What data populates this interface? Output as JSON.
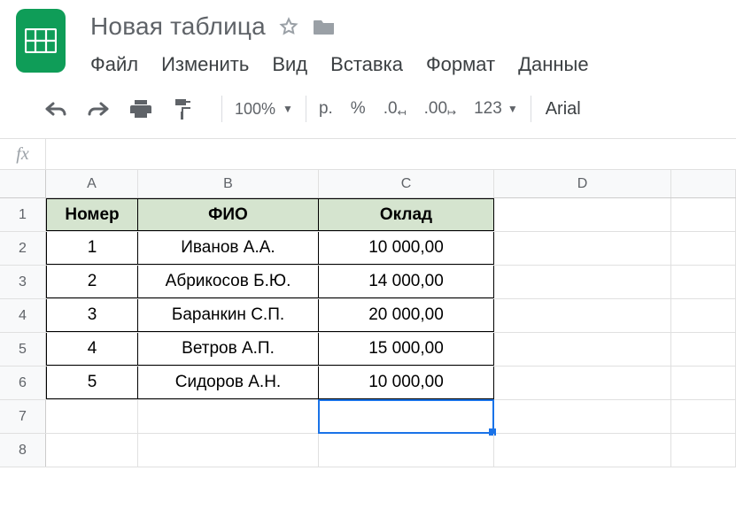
{
  "doc": {
    "title": "Новая таблица"
  },
  "menubar": {
    "file": "Файл",
    "edit": "Изменить",
    "view": "Вид",
    "insert": "Вставка",
    "format": "Формат",
    "data": "Данные"
  },
  "toolbar": {
    "zoom": "100%",
    "currency": "р.",
    "percent": "%",
    "dec_dec": ".0",
    "inc_dec": ".00",
    "numfmt": "123",
    "font": "Arial"
  },
  "formula_bar": {
    "fx": "fx",
    "value": ""
  },
  "columns": [
    "A",
    "B",
    "C",
    "D",
    ""
  ],
  "rows": [
    "1",
    "2",
    "3",
    "4",
    "5",
    "6",
    "7",
    "8"
  ],
  "sheet": {
    "headers": {
      "A": "Номер",
      "B": "ФИО",
      "C": "Оклад"
    },
    "data": [
      {
        "num": "1",
        "name": "Иванов А.А.",
        "salary": "10 000,00"
      },
      {
        "num": "2",
        "name": "Абрикосов Б.Ю.",
        "salary": "14 000,00"
      },
      {
        "num": "3",
        "name": "Баранкин С.П.",
        "salary": "20 000,00"
      },
      {
        "num": "4",
        "name": "Ветров А.П.",
        "salary": "15 000,00"
      },
      {
        "num": "5",
        "name": "Сидоров А.Н.",
        "salary": "10 000,00"
      }
    ]
  },
  "selection": {
    "cell": "C7"
  }
}
